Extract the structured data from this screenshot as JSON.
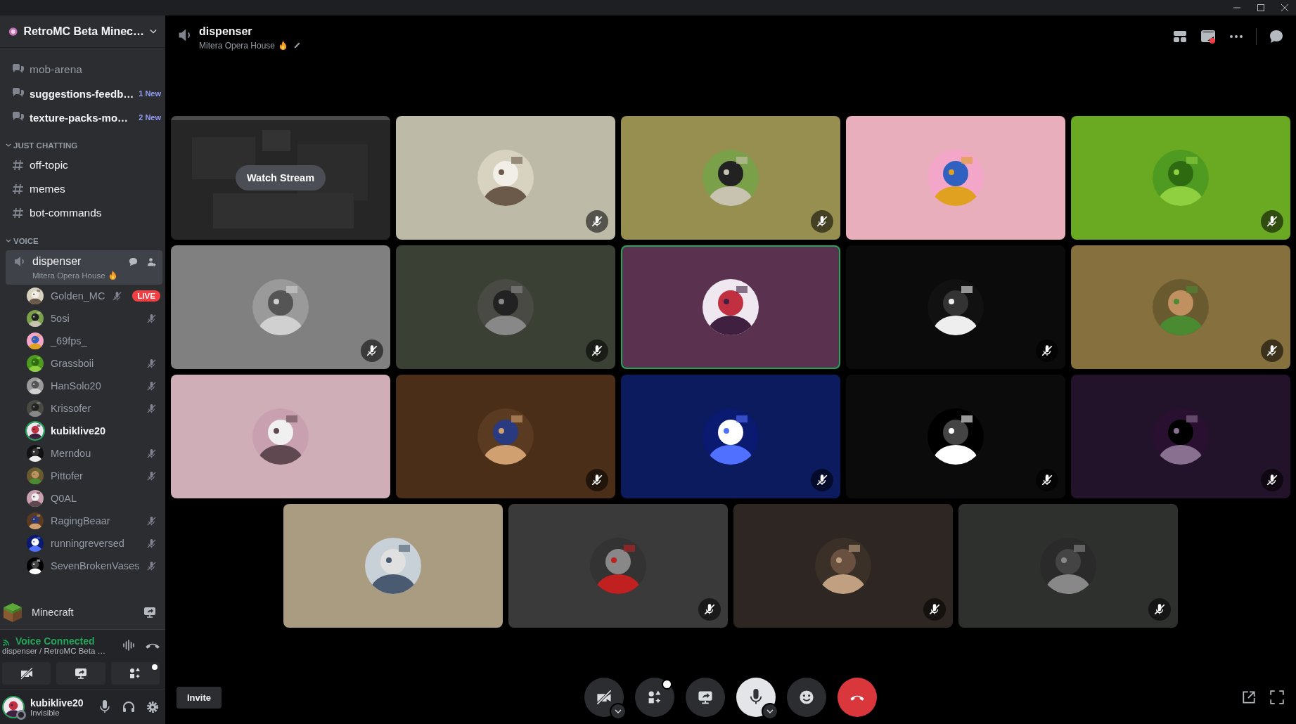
{
  "server": {
    "name": "RetroMC Beta Minec…"
  },
  "forum_channels": [
    {
      "name": "mob-arena",
      "unread": false
    },
    {
      "name": "suggestions-feedb…",
      "unread": true,
      "badge": "1 New"
    },
    {
      "name": "texture-packs-mo…",
      "unread": true,
      "badge": "2 New"
    }
  ],
  "categories": [
    {
      "title": "JUST CHATTING",
      "expanded": true,
      "channels": [
        {
          "name": "off-topic"
        },
        {
          "name": "memes"
        },
        {
          "name": "bot-commands"
        }
      ]
    },
    {
      "title": "VOICE",
      "expanded": true,
      "voice_channel": {
        "name": "dispenser",
        "status": "Mitera Opera House",
        "selected": true,
        "members": [
          {
            "name": "Golden_MC",
            "muted": true,
            "speaking": false,
            "live": "LIVE"
          },
          {
            "name": "5osi",
            "muted": true,
            "speaking": false
          },
          {
            "name": "_69fps_",
            "muted": false,
            "speaking": false
          },
          {
            "name": "Grassboii",
            "muted": true,
            "speaking": false
          },
          {
            "name": "HanSolo20",
            "muted": true,
            "speaking": false
          },
          {
            "name": "Krissofer",
            "muted": true,
            "speaking": false
          },
          {
            "name": "kubiklive20",
            "muted": false,
            "speaking": true
          },
          {
            "name": "Merndou",
            "muted": true,
            "speaking": false
          },
          {
            "name": "Pittofer",
            "muted": true,
            "speaking": false
          },
          {
            "name": "Q0AL",
            "muted": false,
            "speaking": false
          },
          {
            "name": "RagingBeaar",
            "muted": true,
            "speaking": false
          },
          {
            "name": "runningreversed",
            "muted": true,
            "speaking": false
          },
          {
            "name": "SevenBrokenVases",
            "muted": true,
            "speaking": false
          }
        ]
      }
    }
  ],
  "activity": {
    "name": "Minecraft"
  },
  "voice": {
    "status": "Voice Connected",
    "location": "dispenser / RetroMC Beta …"
  },
  "user": {
    "name": "kubiklive20",
    "status": "Invisible"
  },
  "call_header": {
    "channel": "dispenser",
    "status": "Mitera Opera House"
  },
  "tiles": [
    {
      "kind": "stream",
      "color": "#2a2a2a",
      "button": "Watch Stream"
    },
    {
      "kind": "user",
      "color": "#bdbba8",
      "muted": true,
      "speaking": false
    },
    {
      "kind": "user",
      "color": "#968f50",
      "muted": true,
      "speaking": false
    },
    {
      "kind": "user",
      "color": "#e8aebb",
      "muted": false,
      "speaking": false
    },
    {
      "kind": "user",
      "color": "#6aaa22",
      "muted": true,
      "speaking": false
    },
    {
      "kind": "user",
      "color": "#808080",
      "muted": true,
      "speaking": false
    },
    {
      "kind": "user",
      "color": "#3b4034",
      "muted": true,
      "speaking": false
    },
    {
      "kind": "user",
      "color": "#5a3250",
      "muted": false,
      "speaking": true
    },
    {
      "kind": "user",
      "color": "#0b0b0b",
      "muted": true,
      "speaking": false
    },
    {
      "kind": "user",
      "color": "#85703e",
      "muted": true,
      "speaking": false
    },
    {
      "kind": "user",
      "color": "#d0aeb8",
      "muted": false,
      "speaking": false
    },
    {
      "kind": "user",
      "color": "#4a2e18",
      "muted": true,
      "speaking": false
    },
    {
      "kind": "user",
      "color": "#0c1a5e",
      "muted": true,
      "speaking": false
    },
    {
      "kind": "user",
      "color": "#0b0b0b",
      "muted": true,
      "speaking": false
    },
    {
      "kind": "user",
      "color": "#22122a",
      "muted": true,
      "speaking": false
    },
    {
      "kind": "user",
      "color": "#aa9c80",
      "muted": false,
      "speaking": false
    },
    {
      "kind": "user",
      "color": "#3a3a3a",
      "muted": true,
      "speaking": false
    },
    {
      "kind": "user",
      "color": "#2e2622",
      "muted": true,
      "speaking": false
    },
    {
      "kind": "user",
      "color": "#2e302e",
      "muted": true,
      "speaking": false
    }
  ],
  "invite": "Invite",
  "controls": {
    "mic_on": true
  }
}
